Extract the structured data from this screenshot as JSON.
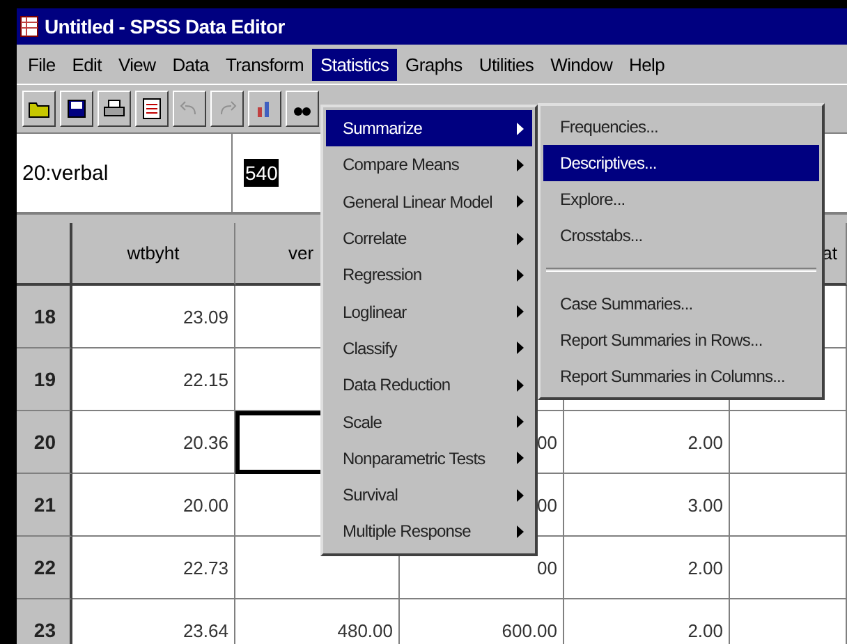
{
  "window": {
    "title": "Untitled - SPSS Data Editor"
  },
  "menu_bar": [
    {
      "label": "File",
      "selected": false
    },
    {
      "label": "Edit",
      "selected": false
    },
    {
      "label": "View",
      "selected": false
    },
    {
      "label": "Data",
      "selected": false
    },
    {
      "label": "Transform",
      "selected": false
    },
    {
      "label": "Statistics",
      "selected": true
    },
    {
      "label": "Graphs",
      "selected": false
    },
    {
      "label": "Utilities",
      "selected": false
    },
    {
      "label": "Window",
      "selected": false
    },
    {
      "label": "Help",
      "selected": false
    }
  ],
  "toolbar": [
    {
      "kind": "open",
      "disabled": false
    },
    {
      "kind": "save",
      "disabled": false
    },
    {
      "kind": "print",
      "disabled": false
    },
    {
      "kind": "recall",
      "disabled": false
    },
    {
      "kind": "undo",
      "disabled": true
    },
    {
      "kind": "redo",
      "disabled": true
    },
    {
      "kind": "chart",
      "disabled": false
    },
    {
      "kind": "find",
      "disabled": false
    }
  ],
  "cell_editor": {
    "cell": "20:verbal",
    "value": "540"
  },
  "table": {
    "columns": [
      "wtbyht",
      "ver",
      "",
      "",
      "at"
    ],
    "rows": [
      {
        "number": "18",
        "cells": [
          {
            "text": "23.09",
            "active": false
          },
          {
            "text": "",
            "active": false
          }
        ]
      },
      {
        "number": "19",
        "cells": [
          {
            "text": "22.15",
            "active": false
          },
          {
            "text": "",
            "active": false
          },
          {
            "text": "",
            "active": false
          },
          {
            "text": "",
            "active": false
          },
          {
            "text": "",
            "active": false
          }
        ]
      },
      {
        "number": "20",
        "cells": [
          {
            "text": "20.36",
            "active": false
          },
          {
            "text": "",
            "active": true
          },
          {
            "text": "00",
            "active": false
          },
          {
            "text": "2.00",
            "active": false
          },
          {
            "text": "",
            "active": false
          }
        ]
      },
      {
        "number": "21",
        "cells": [
          {
            "text": "20.00",
            "active": false
          },
          {
            "text": "",
            "active": false
          },
          {
            "text": "00",
            "active": false
          },
          {
            "text": "3.00",
            "active": false
          },
          {
            "text": "",
            "active": false
          }
        ]
      },
      {
        "number": "22",
        "cells": [
          {
            "text": "22.73",
            "active": false
          },
          {
            "text": "",
            "active": false
          },
          {
            "text": "00",
            "active": false
          },
          {
            "text": "2.00",
            "active": false
          },
          {
            "text": "",
            "active": false
          }
        ]
      },
      {
        "number": "23",
        "cells": [
          {
            "text": "23.64",
            "active": false
          },
          {
            "text": "480.00",
            "active": false
          },
          {
            "text": "600.00",
            "active": false
          },
          {
            "text": "2.00",
            "active": false
          },
          {
            "text": "",
            "active": false
          }
        ]
      }
    ]
  },
  "statistics_menu": [
    {
      "label": "Summarize",
      "selected": true
    },
    {
      "label": "Compare Means",
      "selected": false
    },
    {
      "label": "General Linear Model",
      "selected": false
    },
    {
      "label": "Correlate",
      "selected": false
    },
    {
      "label": "Regression",
      "selected": false
    },
    {
      "label": "Loglinear",
      "selected": false
    },
    {
      "label": "Classify",
      "selected": false
    },
    {
      "label": "Data Reduction",
      "selected": false
    },
    {
      "label": "Scale",
      "selected": false
    },
    {
      "label": "Nonparametric Tests",
      "selected": false
    },
    {
      "label": "Survival",
      "selected": false
    },
    {
      "label": "Multiple Response",
      "selected": false
    }
  ],
  "summarize_submenu": [
    {
      "kind": "item",
      "label": "Frequencies...",
      "selected": false
    },
    {
      "kind": "item",
      "label": "Descriptives...",
      "selected": true
    },
    {
      "kind": "item",
      "label": "Explore...",
      "selected": false
    },
    {
      "kind": "item",
      "label": "Crosstabs...",
      "selected": false
    },
    {
      "kind": "separator"
    },
    {
      "kind": "item",
      "label": "Case Summaries...",
      "selected": false
    },
    {
      "kind": "item",
      "label": "Report Summaries in Rows...",
      "selected": false
    },
    {
      "kind": "item",
      "label": "Report Summaries in Columns...",
      "selected": false
    }
  ]
}
